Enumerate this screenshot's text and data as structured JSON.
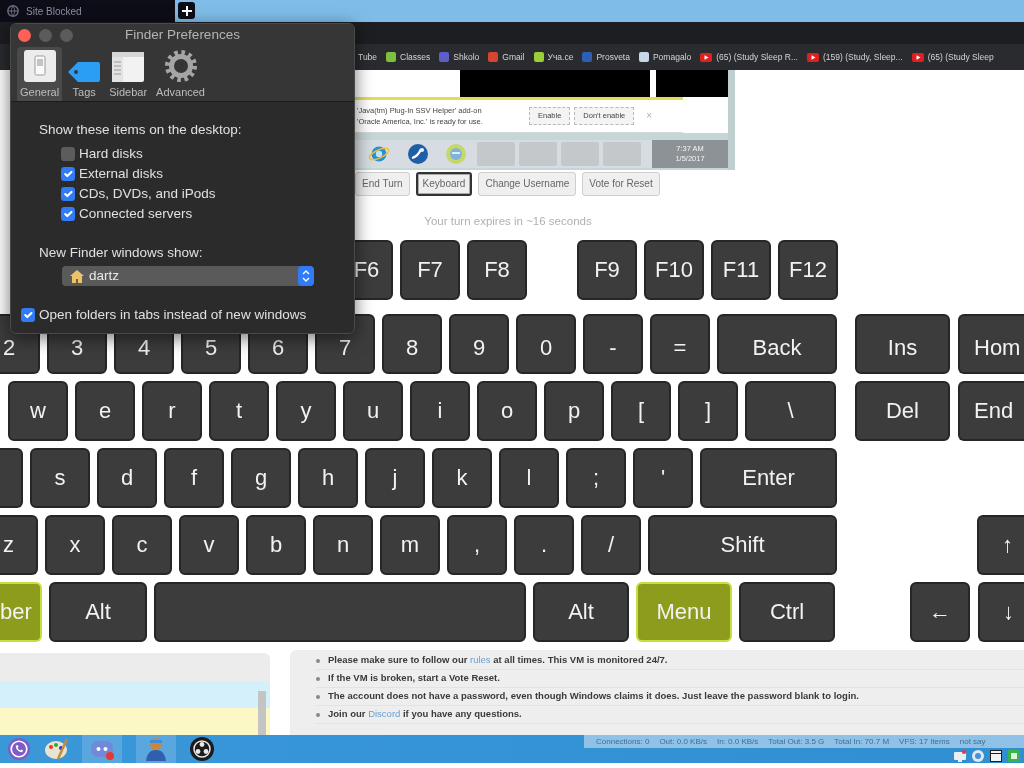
{
  "browser": {
    "tab": {
      "title": "Site Blocked"
    },
    "bookmarks": [
      {
        "label": "Tube",
        "kind": "text"
      },
      {
        "label": "Classes",
        "kind": "tile",
        "color": "#7fbf3f"
      },
      {
        "label": "Shkolo",
        "kind": "tile",
        "color": "#5b5fc7"
      },
      {
        "label": "Gmail",
        "kind": "tile",
        "color": "#d8452f"
      },
      {
        "label": "Уча.се",
        "kind": "tile",
        "color": "#9ccc3a"
      },
      {
        "label": "Prosveta",
        "kind": "tile",
        "color": "#2d5fb4"
      },
      {
        "label": "Pomagalo",
        "kind": "tile",
        "color": "#c8d6ea"
      },
      {
        "label": "(65) (Study Sleep R...",
        "kind": "play"
      },
      {
        "label": "(159) (Study, Sleep...",
        "kind": "play"
      },
      {
        "label": "(65) (Study Sleep",
        "kind": "play"
      }
    ]
  },
  "finder_window": {
    "title": "Finder Preferences",
    "tabs": [
      {
        "label": "General",
        "kind": "panel",
        "selected": true
      },
      {
        "label": "Tags",
        "kind": "tag",
        "selected": false
      },
      {
        "label": "Sidebar",
        "kind": "sidebar",
        "selected": false
      },
      {
        "label": "Advanced",
        "kind": "gear",
        "selected": false
      }
    ],
    "desktop_heading": "Show these items on the desktop:",
    "desktop_items": [
      {
        "label": "Hard disks",
        "checked": false
      },
      {
        "label": "External disks",
        "checked": true
      },
      {
        "label": "CDs, DVDs, and iPods",
        "checked": true
      },
      {
        "label": "Connected servers",
        "checked": true
      }
    ],
    "new_window_heading": "New Finder windows show:",
    "new_window_target": "dartz",
    "open_in_tabs": {
      "label": "Open folders in tabs instead of new windows",
      "checked": true
    }
  },
  "vm_screen": {
    "notification": {
      "lines": [
        "'Java(tm) Plug-In SSV Helper' add-on",
        "'Oracle America, Inc.' is ready for use."
      ],
      "buttons": [
        "Enable",
        "Don't enable"
      ],
      "close": "×"
    },
    "clock": {
      "time": "7:37 AM",
      "date": "1/5/2017"
    }
  },
  "controls": [
    {
      "label": "End Turn",
      "selected": false
    },
    {
      "label": "Keyboard",
      "selected": true
    },
    {
      "label": "Change Username",
      "selected": false
    },
    {
      "label": "Vote for Reset",
      "selected": false
    }
  ],
  "turn_notice": "Your turn expires in ~16 seconds",
  "keyboard": {
    "rows": [
      {
        "keys": [
          {
            "label": "F6",
            "pressed": false
          },
          {
            "label": "F7",
            "pressed": false
          },
          {
            "label": "F8",
            "pressed": false
          },
          {
            "label": "F9",
            "pressed": false
          },
          {
            "label": "F10",
            "pressed": false
          },
          {
            "label": "F11",
            "pressed": false
          },
          {
            "label": "F12",
            "pressed": false
          }
        ]
      },
      {
        "keys": [
          {
            "label": "2",
            "pressed": false
          },
          {
            "label": "3",
            "pressed": false
          },
          {
            "label": "4",
            "pressed": false
          },
          {
            "label": "5",
            "pressed": false
          },
          {
            "label": "6",
            "pressed": false
          },
          {
            "label": "7",
            "pressed": false
          },
          {
            "label": "8",
            "pressed": false
          },
          {
            "label": "9",
            "pressed": false
          },
          {
            "label": "0",
            "pressed": false
          },
          {
            "label": "-",
            "pressed": false
          },
          {
            "label": "=",
            "pressed": false
          },
          {
            "label": "Back",
            "pressed": false
          }
        ],
        "right_keys": [
          {
            "label": "Ins",
            "pressed": false
          },
          {
            "label": "Hom",
            "pressed": false
          }
        ]
      },
      {
        "keys": [
          {
            "label": "w",
            "pressed": false
          },
          {
            "label": "e",
            "pressed": false
          },
          {
            "label": "r",
            "pressed": false
          },
          {
            "label": "t",
            "pressed": false
          },
          {
            "label": "y",
            "pressed": false
          },
          {
            "label": "u",
            "pressed": false
          },
          {
            "label": "i",
            "pressed": false
          },
          {
            "label": "o",
            "pressed": false
          },
          {
            "label": "p",
            "pressed": false
          },
          {
            "label": "[",
            "pressed": false
          },
          {
            "label": "]",
            "pressed": false
          },
          {
            "label": "\\",
            "pressed": false
          }
        ],
        "right_keys": [
          {
            "label": "Del",
            "pressed": false
          },
          {
            "label": "End",
            "pressed": false
          }
        ]
      },
      {
        "keys": [
          {
            "pressed": false
          },
          {
            "label": "s",
            "pressed": false
          },
          {
            "label": "d",
            "pressed": false
          },
          {
            "label": "f",
            "pressed": false
          },
          {
            "label": "g",
            "pressed": false
          },
          {
            "label": "h",
            "pressed": false
          },
          {
            "label": "j",
            "pressed": false
          },
          {
            "label": "k",
            "pressed": false
          },
          {
            "label": "l",
            "pressed": false
          },
          {
            "label": ";",
            "pressed": false
          },
          {
            "label": "'",
            "pressed": false
          },
          {
            "label": "Enter",
            "pressed": false
          }
        ]
      },
      {
        "keys": [
          {
            "label": "z",
            "pressed": false
          },
          {
            "label": "x",
            "pressed": false
          },
          {
            "label": "c",
            "pressed": false
          },
          {
            "label": "v",
            "pressed": false
          },
          {
            "label": "b",
            "pressed": false
          },
          {
            "label": "n",
            "pressed": false
          },
          {
            "label": "m",
            "pressed": false
          },
          {
            "label": ",",
            "pressed": false
          },
          {
            "label": ".",
            "pressed": false
          },
          {
            "label": "/",
            "pressed": false
          },
          {
            "label": "Shift",
            "pressed": false
          }
        ],
        "right_keys": [
          {
            "label": "↑",
            "pressed": false
          }
        ]
      },
      {
        "keys": [
          {
            "label": "ber",
            "pressed": true
          },
          {
            "label": "Alt",
            "pressed": false
          },
          {
            "pressed": false
          },
          {
            "label": "Alt",
            "pressed": false
          },
          {
            "label": "Menu",
            "pressed": true
          },
          {
            "label": "Ctrl",
            "pressed": false
          }
        ],
        "right_keys": [
          {
            "label": "←",
            "pressed": false
          },
          {
            "label": "↓",
            "pressed": false
          }
        ]
      }
    ]
  },
  "notes": [
    {
      "text": "Please make sure to follow our ",
      "link": "rules",
      "text_after": " at all times. This VM is monitored 24/7."
    },
    {
      "text": "If the VM is broken, start a Vote Reset."
    },
    {
      "text": "The account does not have a password, even though Windows claims it does. Just leave the password blank to login."
    },
    {
      "text": "Join our ",
      "link": "Discord",
      "text_after": " if you have any questions."
    }
  ],
  "status_bar": {
    "stats": [
      "Connections: 0",
      "Out: 0.0 KB/s",
      "In: 0.0 KB/s",
      "Total Out: 3.5 G",
      "Total In: 70.7 M",
      "VFS: 17 Items",
      "not say"
    ]
  }
}
